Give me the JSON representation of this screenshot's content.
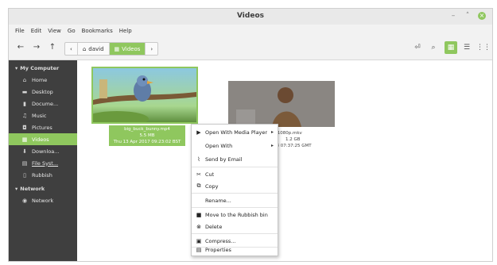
{
  "window": {
    "title": "Videos",
    "controls": [
      "–",
      "˄",
      "×"
    ]
  },
  "menubar": [
    "File",
    "Edit",
    "View",
    "Go",
    "Bookmarks",
    "Help"
  ],
  "toolbar": {
    "crumbs": [
      {
        "label": "david",
        "icon": "home-icon"
      },
      {
        "label": "Videos",
        "icon": "video-folder-icon",
        "active": true
      }
    ]
  },
  "sidebar": {
    "sections": [
      {
        "title": "My Computer",
        "items": [
          {
            "label": "Home",
            "icon": "home-icon"
          },
          {
            "label": "Desktop",
            "icon": "desktop-icon"
          },
          {
            "label": "Docume...",
            "icon": "documents-icon"
          },
          {
            "label": "Music",
            "icon": "music-icon"
          },
          {
            "label": "Pictures",
            "icon": "pictures-icon"
          },
          {
            "label": "Videos",
            "icon": "videos-icon",
            "active": true
          },
          {
            "label": "Downloa...",
            "icon": "downloads-icon"
          },
          {
            "label": "File Syst...",
            "icon": "filesystem-icon"
          },
          {
            "label": "Rubbish",
            "icon": "trash-icon"
          }
        ]
      },
      {
        "title": "Network",
        "items": [
          {
            "label": "Network",
            "icon": "network-icon"
          }
        ]
      }
    ]
  },
  "files": [
    {
      "name": "big_buck_bunny.mp4",
      "size": "5.5 MB",
      "date": "Thu 13 Apr 2017 09:23:02 BST",
      "selected": true
    },
    {
      "name": "2010.1080p.mkv",
      "size": "1.2 GB",
      "date": "r 2018 07:37:25 GMT",
      "selected": false
    }
  ],
  "context_menu": {
    "items": [
      {
        "label": "Open With Media Player",
        "icon": "play-icon",
        "submenu": true
      },
      {
        "label": "Open With",
        "icon": "",
        "submenu": true
      },
      {
        "label": "Send by Email",
        "icon": "attachment-icon"
      },
      {
        "label": "Cut",
        "icon": "scissors-icon"
      },
      {
        "label": "Copy",
        "icon": "copy-icon"
      },
      {
        "label": "Rename...",
        "icon": ""
      },
      {
        "label": "Move to the Rubbish bin",
        "icon": "trash-icon"
      },
      {
        "label": "Delete",
        "icon": "delete-icon"
      },
      {
        "label": "Compress...",
        "icon": "compress-icon"
      },
      {
        "label": "Properties",
        "icon": "properties-icon"
      }
    ]
  },
  "colors": {
    "accent": "#8fc75e",
    "sidebar_bg": "#3f3f3f"
  }
}
